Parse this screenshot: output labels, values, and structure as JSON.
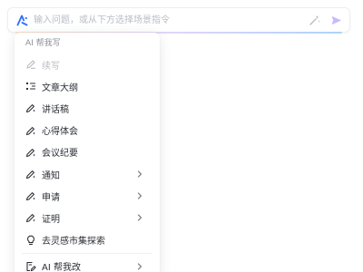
{
  "prompt": {
    "placeholder": "输入问题，或从下方选择场景指令"
  },
  "menu": {
    "header": "AI 帮我写",
    "items": [
      {
        "label": "续写",
        "icon": "pen-icon",
        "disabled": true
      },
      {
        "label": "文章大纲",
        "icon": "outline-list-icon"
      },
      {
        "label": "讲话稿",
        "icon": "pen-sparkle-icon"
      },
      {
        "label": "心得体会",
        "icon": "pen-sparkle-icon"
      },
      {
        "label": "会议纪要",
        "icon": "pen-sparkle-icon"
      },
      {
        "label": "通知",
        "icon": "pen-sparkle-icon",
        "submenu": true
      },
      {
        "label": "申请",
        "icon": "pen-sparkle-icon",
        "submenu": true
      },
      {
        "label": "证明",
        "icon": "pen-sparkle-icon",
        "submenu": true
      },
      {
        "label": "去灵感市集探索",
        "icon": "lightbulb-icon"
      }
    ],
    "footer_item": {
      "label": "AI 帮我改",
      "icon": "edit-doc-icon",
      "submenu": true
    }
  },
  "colors": {
    "accent": "#3370ff",
    "text": "#2b2f36",
    "muted": "#b8bcc4",
    "send": "#c9b8ff"
  }
}
